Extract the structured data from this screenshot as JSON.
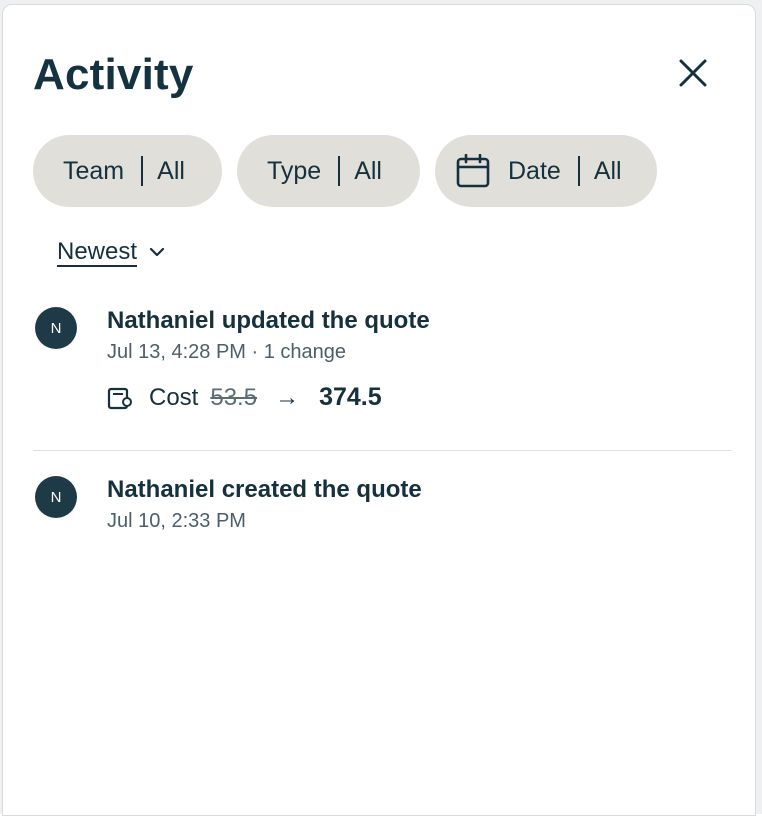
{
  "panel": {
    "title": "Activity",
    "close_icon": "close-icon"
  },
  "filters": [
    {
      "label": "Team",
      "value": "All"
    },
    {
      "label": "Type",
      "value": "All"
    },
    {
      "label": "Date",
      "value": "All",
      "icon": "calendar-icon"
    }
  ],
  "sort": {
    "label": "Newest",
    "icon": "chevron-down-icon"
  },
  "entries": [
    {
      "avatar": "N",
      "title": "Nathaniel updated the quote",
      "meta": "Jul 13, 4:28 PM · 1 change",
      "change": {
        "icon": "receipt-icon",
        "field": "Cost",
        "old": "53.5",
        "arrow": "→",
        "new": "374.5"
      }
    },
    {
      "avatar": "N",
      "title": "Nathaniel created the quote",
      "meta": "Jul 10, 2:33 PM"
    }
  ],
  "colors": {
    "text": "#15313d",
    "chip_bg": "#e1dfda",
    "avatar_bg": "#1f3a47",
    "muted": "#4b5f68"
  }
}
